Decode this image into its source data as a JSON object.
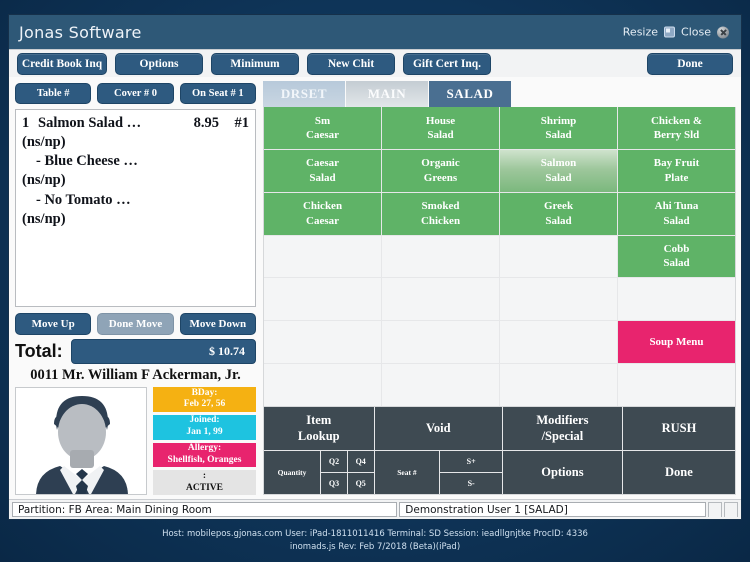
{
  "window": {
    "title": "Jonas Software",
    "resize_label": "Resize",
    "close_label": "Close"
  },
  "toolbar": {
    "buttons": [
      "Credit Book Inq",
      "Options",
      "Minimum",
      "New Chit",
      "Gift Cert Inq."
    ],
    "done_label": "Done"
  },
  "left_panel": {
    "seat_buttons": [
      "Table #",
      "Cover # 0",
      "On Seat # 1"
    ],
    "order": {
      "qty": "1",
      "name": "Salmon Salad  …",
      "price": "8.95",
      "seat": "#1",
      "lines": [
        "(ns/np)",
        "- Blue Cheese …",
        "(ns/np)",
        "- No Tomato   …",
        "(ns/np)"
      ]
    },
    "move_buttons": [
      "Move Up",
      "Done Move",
      "Move Down"
    ],
    "total_label": "Total:",
    "total_value": "$ 10.74",
    "customer_name": "0011 Mr. William F Ackerman, Jr.",
    "badges": [
      {
        "title": "BDay:",
        "value": "Feb 27, 56"
      },
      {
        "title": "Joined:",
        "value": "Jan 1, 99"
      },
      {
        "title": "Allergy:",
        "value": "Shellfish, Oranges"
      },
      {
        "title": ":",
        "value": "ACTIVE"
      }
    ]
  },
  "right_panel": {
    "tabs": [
      {
        "label": "DRSET",
        "active": false
      },
      {
        "label": "MAIN",
        "active": false
      },
      {
        "label": "SALAD",
        "active": true
      }
    ],
    "menu_grid": [
      {
        "label": "Sm\nCaesar",
        "style": "green"
      },
      {
        "label": "House\nSalad",
        "style": "green"
      },
      {
        "label": "Shrimp\nSalad",
        "style": "green"
      },
      {
        "label": "Chicken &\nBerry Sld",
        "style": "green"
      },
      {
        "label": "Caesar\nSalad",
        "style": "green"
      },
      {
        "label": "Organic\nGreens",
        "style": "green"
      },
      {
        "label": "Salmon\nSalad",
        "style": "green-selected"
      },
      {
        "label": "Bay Fruit\nPlate",
        "style": "green"
      },
      {
        "label": "Chicken\nCaesar",
        "style": "green"
      },
      {
        "label": "Smoked\nChicken",
        "style": "green"
      },
      {
        "label": "Greek\nSalad",
        "style": "green"
      },
      {
        "label": "Ahi Tuna\nSalad",
        "style": "green"
      },
      {
        "label": "",
        "style": "empty"
      },
      {
        "label": "",
        "style": "empty"
      },
      {
        "label": "",
        "style": "empty"
      },
      {
        "label": "Cobb\nSalad",
        "style": "green"
      },
      {
        "label": "",
        "style": "empty"
      },
      {
        "label": "",
        "style": "empty"
      },
      {
        "label": "",
        "style": "empty"
      },
      {
        "label": "",
        "style": "empty"
      },
      {
        "label": "",
        "style": "empty"
      },
      {
        "label": "",
        "style": "empty"
      },
      {
        "label": "",
        "style": "empty"
      },
      {
        "label": "Soup Menu",
        "style": "pink"
      },
      {
        "label": "",
        "style": "empty"
      },
      {
        "label": "",
        "style": "empty"
      },
      {
        "label": "",
        "style": "empty"
      },
      {
        "label": "",
        "style": "empty"
      }
    ],
    "actions": {
      "row1": [
        "Item\nLookup",
        "Void",
        "Modifiers\n/Special",
        "RUSH"
      ],
      "quantity_label": "Quantity",
      "quantity_cells": [
        "Q2",
        "Q4",
        "Q3",
        "Q5"
      ],
      "seat_label": "Seat #",
      "seat_cells": [
        "S+",
        "S-"
      ],
      "options_label": "Options",
      "done_label": "Done"
    }
  },
  "status_bar": {
    "partition": "Partition: FB Area: Main Dining Room",
    "user": "Demonstration User 1 [SALAD]"
  },
  "footer": {
    "line1": "Host: mobilepos.gjonas.com User: iPad-1811011416 Terminal: SD Session: ieadllgnjtke ProcID: 4336",
    "line2": "inomads.js Rev: Feb 7/2018 (Beta)(iPad)"
  },
  "colors": {
    "window_chrome": "#2e5877",
    "button_blue": "#2e5a80",
    "menu_green": "#5fb367",
    "accent_pink": "#e8246e",
    "action_slate": "#3e4a52",
    "badge_bday": "#f5b112",
    "badge_joined": "#1ec3e0"
  }
}
